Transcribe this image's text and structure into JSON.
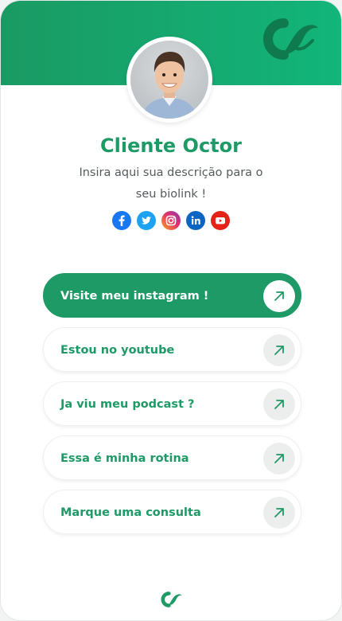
{
  "profile": {
    "name": "Cliente Octor",
    "description_line1": "Insira aqui sua descrição para o",
    "description_line2": "seu biolink !"
  },
  "socials": [
    {
      "icon": "facebook-icon",
      "color": "#1877f2"
    },
    {
      "icon": "twitter-icon",
      "color": "#1da1f2"
    },
    {
      "icon": "instagram-icon",
      "color": "#e1306c"
    },
    {
      "icon": "linkedin-icon",
      "color": "#0a66c2"
    },
    {
      "icon": "youtube-icon",
      "color": "#e62117"
    }
  ],
  "links": [
    {
      "label": "Visite meu instagram !",
      "style": "primary"
    },
    {
      "label": "Estou no youtube",
      "style": "secondary"
    },
    {
      "label": "Ja viu meu podcast ?",
      "style": "secondary"
    },
    {
      "label": "Essa é minha rotina",
      "style": "secondary"
    },
    {
      "label": "Marque uma consulta",
      "style": "secondary"
    }
  ],
  "colors": {
    "brand_green": "#1e9a66",
    "header_gradient_start": "#1a9a63",
    "header_gradient_end": "#12b57a",
    "header_logo": "#0f7a4e"
  },
  "icons": {
    "header_logo": "octor-logo-icon",
    "footer_logo": "octor-logo-icon",
    "link_arrow": "arrow-up-right-icon"
  }
}
